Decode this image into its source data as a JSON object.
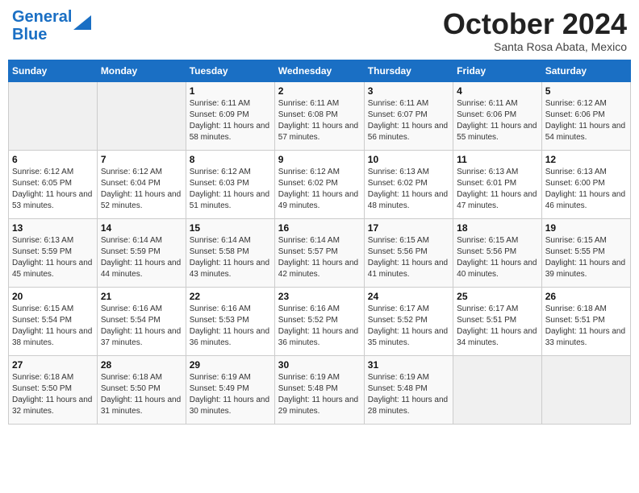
{
  "logo": {
    "line1": "General",
    "line2": "Blue"
  },
  "title": "October 2024",
  "subtitle": "Santa Rosa Abata, Mexico",
  "days_of_week": [
    "Sunday",
    "Monday",
    "Tuesday",
    "Wednesday",
    "Thursday",
    "Friday",
    "Saturday"
  ],
  "weeks": [
    [
      {
        "day": "",
        "info": ""
      },
      {
        "day": "",
        "info": ""
      },
      {
        "day": "1",
        "info": "Sunrise: 6:11 AM\nSunset: 6:09 PM\nDaylight: 11 hours and 58 minutes."
      },
      {
        "day": "2",
        "info": "Sunrise: 6:11 AM\nSunset: 6:08 PM\nDaylight: 11 hours and 57 minutes."
      },
      {
        "day": "3",
        "info": "Sunrise: 6:11 AM\nSunset: 6:07 PM\nDaylight: 11 hours and 56 minutes."
      },
      {
        "day": "4",
        "info": "Sunrise: 6:11 AM\nSunset: 6:06 PM\nDaylight: 11 hours and 55 minutes."
      },
      {
        "day": "5",
        "info": "Sunrise: 6:12 AM\nSunset: 6:06 PM\nDaylight: 11 hours and 54 minutes."
      }
    ],
    [
      {
        "day": "6",
        "info": "Sunrise: 6:12 AM\nSunset: 6:05 PM\nDaylight: 11 hours and 53 minutes."
      },
      {
        "day": "7",
        "info": "Sunrise: 6:12 AM\nSunset: 6:04 PM\nDaylight: 11 hours and 52 minutes."
      },
      {
        "day": "8",
        "info": "Sunrise: 6:12 AM\nSunset: 6:03 PM\nDaylight: 11 hours and 51 minutes."
      },
      {
        "day": "9",
        "info": "Sunrise: 6:12 AM\nSunset: 6:02 PM\nDaylight: 11 hours and 49 minutes."
      },
      {
        "day": "10",
        "info": "Sunrise: 6:13 AM\nSunset: 6:02 PM\nDaylight: 11 hours and 48 minutes."
      },
      {
        "day": "11",
        "info": "Sunrise: 6:13 AM\nSunset: 6:01 PM\nDaylight: 11 hours and 47 minutes."
      },
      {
        "day": "12",
        "info": "Sunrise: 6:13 AM\nSunset: 6:00 PM\nDaylight: 11 hours and 46 minutes."
      }
    ],
    [
      {
        "day": "13",
        "info": "Sunrise: 6:13 AM\nSunset: 5:59 PM\nDaylight: 11 hours and 45 minutes."
      },
      {
        "day": "14",
        "info": "Sunrise: 6:14 AM\nSunset: 5:59 PM\nDaylight: 11 hours and 44 minutes."
      },
      {
        "day": "15",
        "info": "Sunrise: 6:14 AM\nSunset: 5:58 PM\nDaylight: 11 hours and 43 minutes."
      },
      {
        "day": "16",
        "info": "Sunrise: 6:14 AM\nSunset: 5:57 PM\nDaylight: 11 hours and 42 minutes."
      },
      {
        "day": "17",
        "info": "Sunrise: 6:15 AM\nSunset: 5:56 PM\nDaylight: 11 hours and 41 minutes."
      },
      {
        "day": "18",
        "info": "Sunrise: 6:15 AM\nSunset: 5:56 PM\nDaylight: 11 hours and 40 minutes."
      },
      {
        "day": "19",
        "info": "Sunrise: 6:15 AM\nSunset: 5:55 PM\nDaylight: 11 hours and 39 minutes."
      }
    ],
    [
      {
        "day": "20",
        "info": "Sunrise: 6:15 AM\nSunset: 5:54 PM\nDaylight: 11 hours and 38 minutes."
      },
      {
        "day": "21",
        "info": "Sunrise: 6:16 AM\nSunset: 5:54 PM\nDaylight: 11 hours and 37 minutes."
      },
      {
        "day": "22",
        "info": "Sunrise: 6:16 AM\nSunset: 5:53 PM\nDaylight: 11 hours and 36 minutes."
      },
      {
        "day": "23",
        "info": "Sunrise: 6:16 AM\nSunset: 5:52 PM\nDaylight: 11 hours and 36 minutes."
      },
      {
        "day": "24",
        "info": "Sunrise: 6:17 AM\nSunset: 5:52 PM\nDaylight: 11 hours and 35 minutes."
      },
      {
        "day": "25",
        "info": "Sunrise: 6:17 AM\nSunset: 5:51 PM\nDaylight: 11 hours and 34 minutes."
      },
      {
        "day": "26",
        "info": "Sunrise: 6:18 AM\nSunset: 5:51 PM\nDaylight: 11 hours and 33 minutes."
      }
    ],
    [
      {
        "day": "27",
        "info": "Sunrise: 6:18 AM\nSunset: 5:50 PM\nDaylight: 11 hours and 32 minutes."
      },
      {
        "day": "28",
        "info": "Sunrise: 6:18 AM\nSunset: 5:50 PM\nDaylight: 11 hours and 31 minutes."
      },
      {
        "day": "29",
        "info": "Sunrise: 6:19 AM\nSunset: 5:49 PM\nDaylight: 11 hours and 30 minutes."
      },
      {
        "day": "30",
        "info": "Sunrise: 6:19 AM\nSunset: 5:48 PM\nDaylight: 11 hours and 29 minutes."
      },
      {
        "day": "31",
        "info": "Sunrise: 6:19 AM\nSunset: 5:48 PM\nDaylight: 11 hours and 28 minutes."
      },
      {
        "day": "",
        "info": ""
      },
      {
        "day": "",
        "info": ""
      }
    ]
  ]
}
